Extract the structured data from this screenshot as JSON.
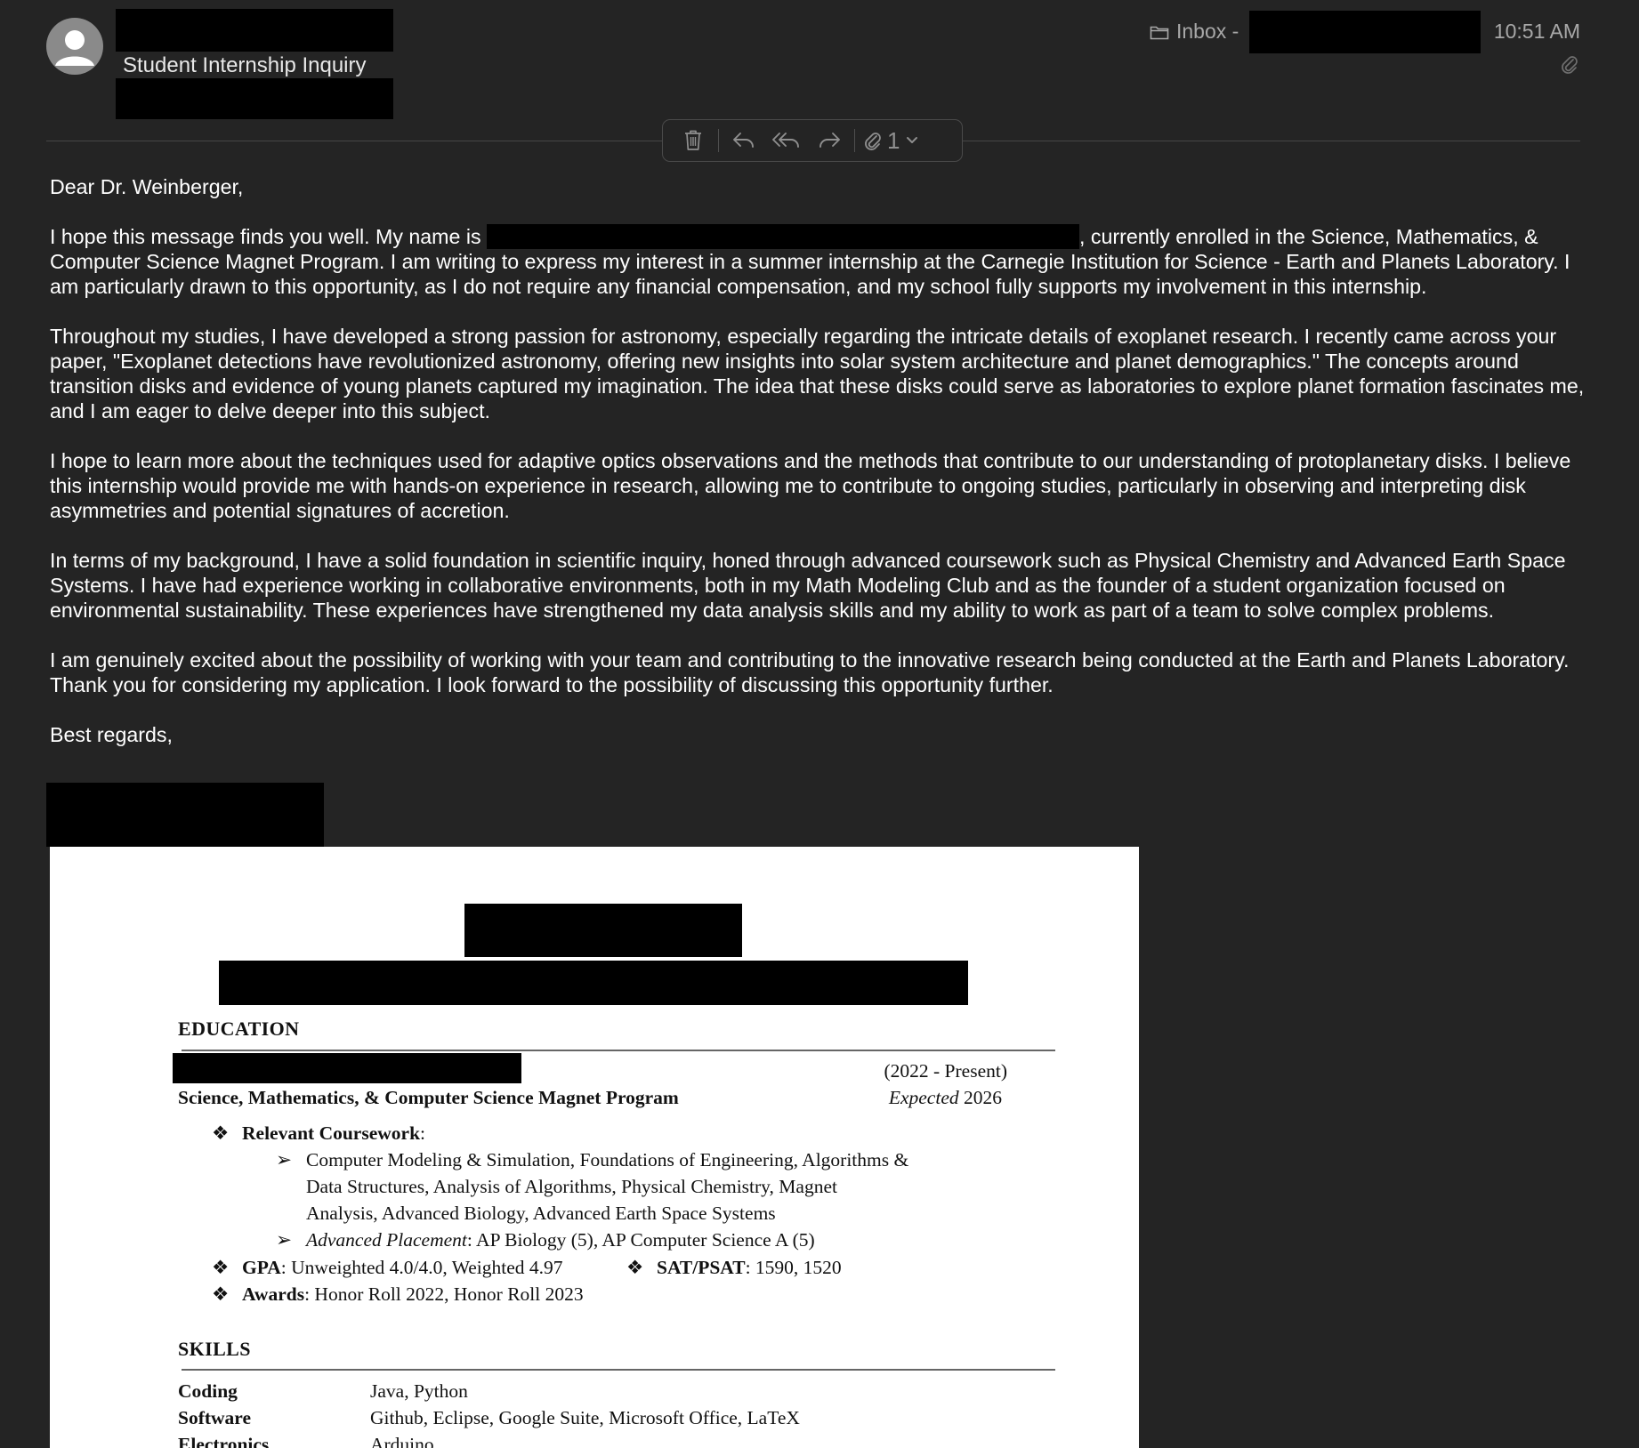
{
  "header": {
    "subject": "Student Internship Inquiry",
    "mailbox_label": "Inbox -",
    "time": "10:51 AM"
  },
  "toolbar": {
    "attachment_count": "1"
  },
  "email": {
    "greeting": "Dear Dr. Weinberger,",
    "p1_before": "I hope this message finds you well. My name is ",
    "p1_after": ", currently enrolled in the Science, Mathematics, & Computer Science Magnet Program. I am writing to express my interest in a summer internship at the Carnegie Institution for Science - Earth and Planets Laboratory. I am particularly drawn to this opportunity, as I do not require any financial compensation, and my school fully supports my involvement in this internship.",
    "p2": "Throughout my studies, I have developed a strong passion for astronomy, especially regarding the intricate details of exoplanet research. I recently came across your paper, \"Exoplanet detections have revolutionized astronomy, offering new insights into solar system architecture and planet demographics.\" The concepts around transition disks and evidence of young planets captured my imagination. The idea that these disks could serve as laboratories to explore planet formation fascinates me, and I am eager to delve deeper into this subject.",
    "p3": "I hope to learn more about the techniques used for adaptive optics observations and the methods that contribute to our understanding of protoplanetary disks. I believe this internship would provide me with hands-on experience in research, allowing me to contribute to ongoing studies, particularly in observing and interpreting disk asymmetries and potential signatures of accretion.",
    "p4": "In terms of my background, I have a solid foundation in scientific inquiry, honed through advanced coursework such as Physical Chemistry and Advanced Earth Space Systems. I have had experience working in collaborative environments, both in my Math Modeling Club and as the founder of a student organization focused on environmental sustainability. These experiences have strengthened my data analysis skills and my ability to work as part of a team to solve complex problems.",
    "p5": "I am genuinely excited about the possibility of working with your team and contributing to the innovative research being conducted at the Earth and Planets Laboratory. Thank you for considering my application. I look forward to the possibility of discussing this opportunity further.",
    "closing": "Best regards,"
  },
  "resume": {
    "education_heading": "EDUCATION",
    "dates": "(2022 - Present)",
    "program": "Science, Mathematics, & Computer Science Magnet Program",
    "expected_label": "Expected",
    "expected_year": "2026",
    "coursework_label": "Relevant Coursework",
    "coursework_line1": "Computer Modeling & Simulation, Foundations of Engineering, Algorithms &",
    "coursework_line2": "Data Structures, Analysis of Algorithms, Physical Chemistry, Magnet",
    "coursework_line3": "Analysis, Advanced Biology, Advanced Earth Space Systems",
    "ap_label": "Advanced Placement",
    "ap_value": ": AP Biology (5), AP Computer Science A (5)",
    "gpa_label": "GPA",
    "gpa_value": ": Unweighted 4.0/4.0, Weighted 4.97",
    "sat_label": "SAT/PSAT",
    "sat_value": ": 1590, 1520",
    "awards_label": "Awards",
    "awards_value": ": Honor Roll 2022, Honor Roll 2023",
    "skills_heading": "SKILLS",
    "skills": [
      {
        "label": "Coding",
        "value": "Java, Python"
      },
      {
        "label": "Software",
        "value": "Github, Eclipse, Google Suite, Microsoft Office, LaTeX"
      },
      {
        "label": "Electronics",
        "value": "Arduino"
      }
    ]
  }
}
